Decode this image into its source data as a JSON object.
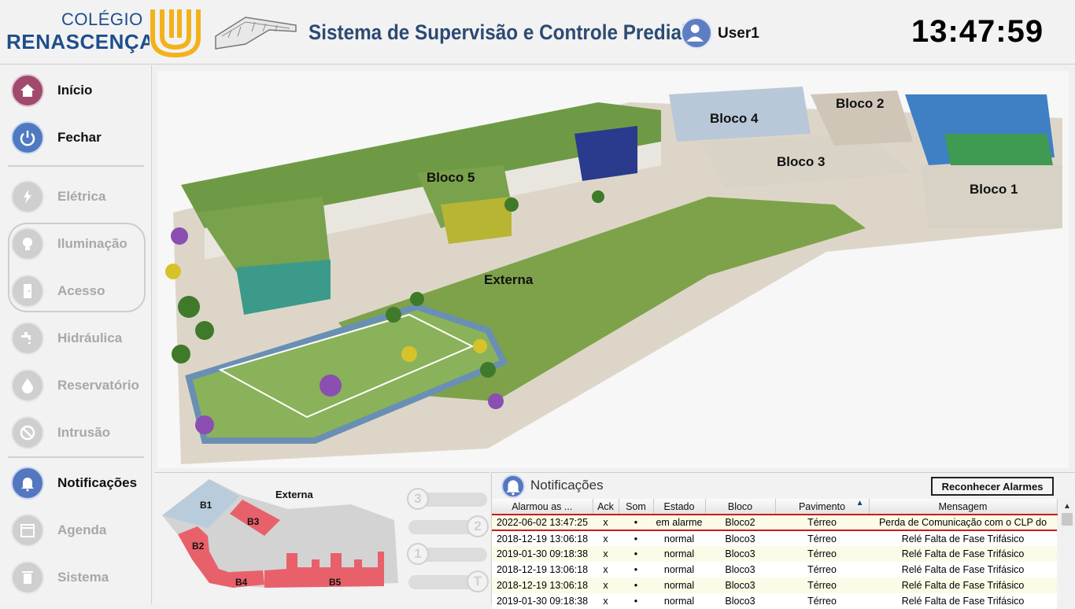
{
  "header": {
    "logo_top": "COLÉGIO",
    "logo_bottom": "RENASCENÇA",
    "system_title": "Sistema de Supervisão e Controle Predial",
    "user": "User1",
    "clock": "13:47:59"
  },
  "sidebar": {
    "items": [
      {
        "label": "Início",
        "icon": "home-icon"
      },
      {
        "label": "Fechar",
        "icon": "power-icon"
      },
      {
        "label": "Elétrica",
        "icon": "lightning-icon"
      },
      {
        "label": "Iluminação",
        "icon": "lightbulb-icon"
      },
      {
        "label": "Acesso",
        "icon": "door-icon"
      },
      {
        "label": "Hidráulica",
        "icon": "faucet-icon"
      },
      {
        "label": "Reservatório",
        "icon": "water-drop-icon"
      },
      {
        "label": "Intrusão",
        "icon": "no-entry-icon"
      },
      {
        "label": "Notificações",
        "icon": "bell-icon"
      },
      {
        "label": "Agenda",
        "icon": "calendar-icon"
      },
      {
        "label": "Sistema",
        "icon": "trash-icon"
      }
    ]
  },
  "main": {
    "blocks": {
      "bloco1": "Bloco 1",
      "bloco2": "Bloco 2",
      "bloco3": "Bloco 3",
      "bloco4": "Bloco 4",
      "bloco5": "Bloco 5",
      "externa": "Externa"
    }
  },
  "minimap": {
    "externa": "Externa",
    "b1": "B1",
    "b2": "B2",
    "b3": "B3",
    "b4": "B4",
    "b5": "B5",
    "floors": [
      "3",
      "2",
      "1",
      "T"
    ]
  },
  "notifications": {
    "title": "Notificações",
    "ack_button": "Reconhecer Alarmes",
    "columns": [
      "Alarmou as ...",
      "Ack",
      "Som",
      "Estado",
      "Bloco",
      "Pavimento",
      "Mensagem"
    ],
    "rows": [
      [
        "2022-06-02 13:47:25",
        "x",
        "•",
        "em alarme",
        "Bloco2",
        "Térreo",
        "Perda de Comunicação com o CLP do"
      ],
      [
        "2018-12-19 13:06:18",
        "x",
        "•",
        "normal",
        "Bloco3",
        "Térreo",
        "Relé Falta de Fase Trifásico"
      ],
      [
        "2019-01-30 09:18:38",
        "x",
        "•",
        "normal",
        "Bloco3",
        "Térreo",
        "Relé Falta de Fase Trifásico"
      ],
      [
        "2018-12-19 13:06:18",
        "x",
        "•",
        "normal",
        "Bloco3",
        "Térreo",
        "Relé Falta de Fase Trifásico"
      ],
      [
        "2018-12-19 13:06:18",
        "x",
        "•",
        "normal",
        "Bloco3",
        "Térreo",
        "Relé Falta de Fase Trifásico"
      ],
      [
        "2019-01-30 09:18:38",
        "x",
        "•",
        "normal",
        "Bloco3",
        "Térreo",
        "Relé Falta de Fase Trifásico"
      ]
    ]
  },
  "colors": {
    "brand_blue": "#1f4e8c",
    "brand_yellow": "#f2b21c",
    "alarm_red": "#cc1b1b",
    "minimap_pink": "#e8616a"
  }
}
